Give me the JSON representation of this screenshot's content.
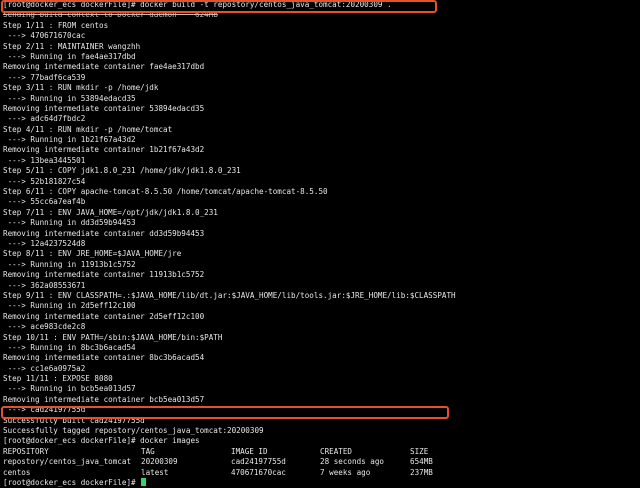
{
  "terminal": {
    "build_command": "[root@docker_ecs dockerFile]# docker build -t repostory/centos_java_tomcat:20200309 .",
    "context_line": "Sending build context to Docker daemon    624MB",
    "build_lines": [
      "Step 1/11 : FROM centos",
      " ---> 470671670cac",
      "Step 2/11 : MAINTAINER wangzhh",
      " ---> Running in fae4ae317dbd",
      "Removing intermediate container fae4ae317dbd",
      " ---> 77badf6ca539",
      "Step 3/11 : RUN mkdir -p /home/jdk",
      " ---> Running in 53894edacd35",
      "Removing intermediate container 53894edacd35",
      " ---> adc64d7fbdc2",
      "Step 4/11 : RUN mkdir -p /home/tomcat",
      " ---> Running in 1b21f67a43d2",
      "Removing intermediate container 1b21f67a43d2",
      " ---> 13bea3445501",
      "Step 5/11 : COPY jdk1.8.0_231 /home/jdk/jdk1.8.0_231",
      " ---> 52b181827c54",
      "Step 6/11 : COPY apache-tomcat-8.5.50 /home/tomcat/apache-tomcat-8.5.50",
      " ---> 55cc6a7eaf4b",
      "Step 7/11 : ENV JAVA_HOME=/opt/jdk/jdk1.8.0_231",
      " ---> Running in dd3d59b94453",
      "Removing intermediate container dd3d59b94453",
      " ---> 12a4237524d8",
      "Step 8/11 : ENV JRE_HOME=$JAVA_HOME/jre",
      " ---> Running in 11913b1c5752",
      "Removing intermediate container 11913b1c5752",
      " ---> 362a08553671",
      "Step 9/11 : ENV CLASSPATH=.:$JAVA_HOME/lib/dt.jar:$JAVA_HOME/lib/tools.jar:$JRE_HOME/lib:$CLASSPATH",
      " ---> Running in 2d5eff12c100",
      "Removing intermediate container 2d5eff12c100",
      " ---> ace983cde2c8",
      "Step 10/11 : ENV PATH=/sbin:$JAVA_HOME/bin:$PATH",
      " ---> Running in 8bc3b6acad54",
      "Removing intermediate container 8bc3b6acad54",
      " ---> cc1e6a0975a2",
      "Step 11/11 : EXPOSE 8080",
      " ---> Running in bcb5ea013d57",
      "Removing intermediate container bcb5ea013d57",
      " ---> cad24197755d",
      "Successfully built cad24197755d",
      "Successfully tagged repostory/centos_java_tomcat:20200309"
    ],
    "images_command": "[root@docker_ecs dockerFile]# docker images",
    "images_table": {
      "headers": [
        "REPOSITORY",
        "TAG",
        "IMAGE ID",
        "CREATED",
        "SIZE"
      ],
      "rows": [
        [
          "repostory/centos_java_tomcat",
          "20200309",
          "cad24197755d",
          "28 seconds ago",
          "654MB"
        ],
        [
          "centos",
          "latest",
          "470671670cac",
          "7 weeks ago",
          "237MB"
        ]
      ]
    },
    "final_prompt": "[root@docker_ecs dockerFile]# ",
    "colors": {
      "background": "#000000",
      "text": "#e6e6e6",
      "highlight_border": "#e8502b",
      "cursor": "#2fd66a"
    }
  }
}
